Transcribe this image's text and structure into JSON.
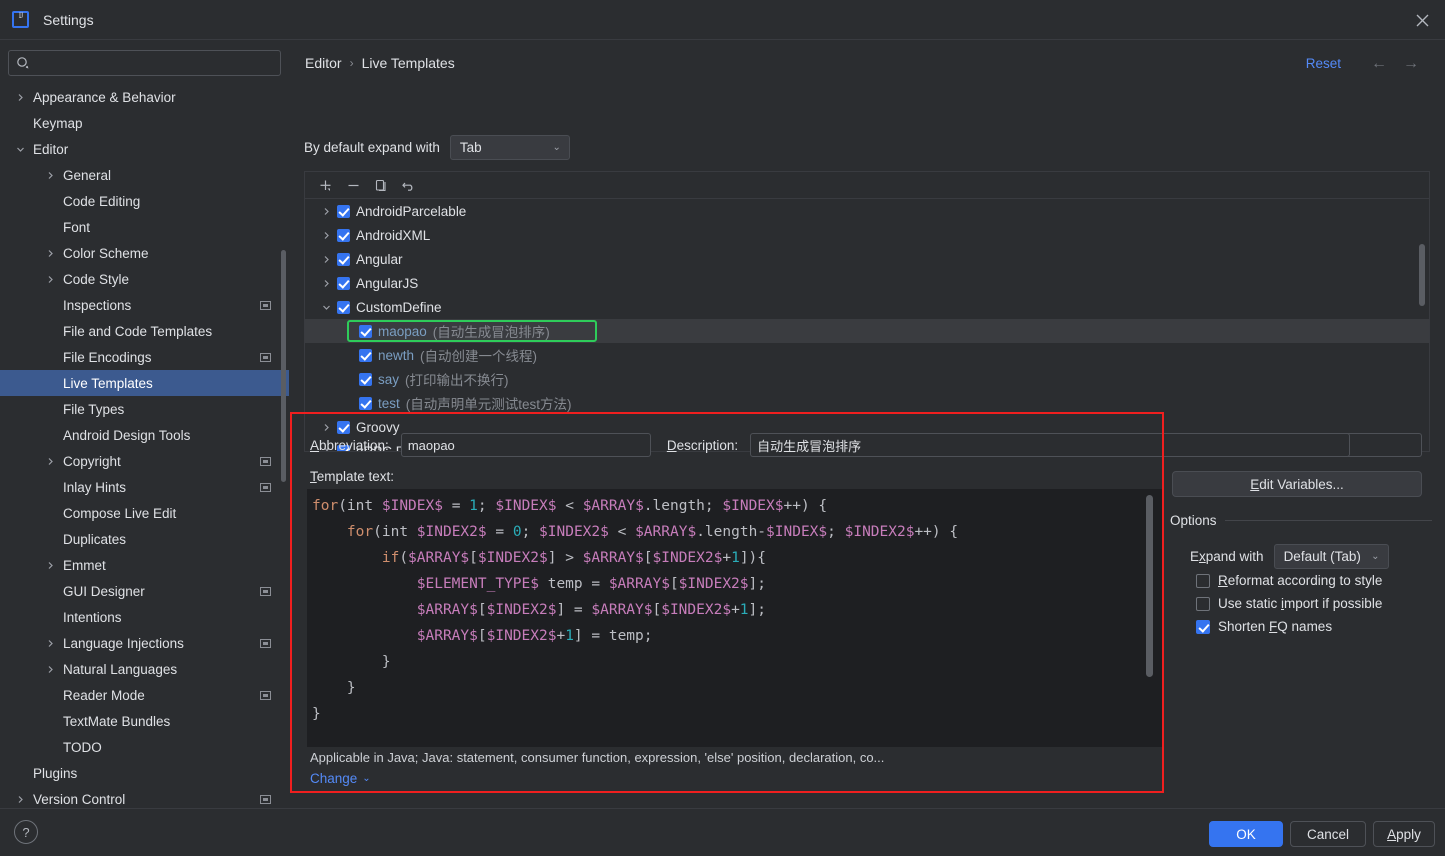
{
  "window": {
    "title": "Settings",
    "logo_icon": "intellij-idea-logo",
    "close_icon": "close-icon"
  },
  "search": {
    "placeholder": "",
    "value": "",
    "icon": "search-icon"
  },
  "sidebar": {
    "items": [
      {
        "label": "Appearance & Behavior",
        "indent": 0,
        "expandable": true,
        "expanded": false,
        "selected": false,
        "badge": false
      },
      {
        "label": "Keymap",
        "indent": 0,
        "expandable": false,
        "expanded": false,
        "selected": false,
        "badge": false
      },
      {
        "label": "Editor",
        "indent": 0,
        "expandable": true,
        "expanded": true,
        "selected": false,
        "badge": false
      },
      {
        "label": "General",
        "indent": 1,
        "expandable": true,
        "expanded": false,
        "selected": false,
        "badge": false
      },
      {
        "label": "Code Editing",
        "indent": 1,
        "expandable": false,
        "expanded": false,
        "selected": false,
        "badge": false
      },
      {
        "label": "Font",
        "indent": 1,
        "expandable": false,
        "expanded": false,
        "selected": false,
        "badge": false
      },
      {
        "label": "Color Scheme",
        "indent": 1,
        "expandable": true,
        "expanded": false,
        "selected": false,
        "badge": false
      },
      {
        "label": "Code Style",
        "indent": 1,
        "expandable": true,
        "expanded": false,
        "selected": false,
        "badge": false
      },
      {
        "label": "Inspections",
        "indent": 1,
        "expandable": false,
        "expanded": false,
        "selected": false,
        "badge": true
      },
      {
        "label": "File and Code Templates",
        "indent": 1,
        "expandable": false,
        "expanded": false,
        "selected": false,
        "badge": false
      },
      {
        "label": "File Encodings",
        "indent": 1,
        "expandable": false,
        "expanded": false,
        "selected": false,
        "badge": true
      },
      {
        "label": "Live Templates",
        "indent": 1,
        "expandable": false,
        "expanded": false,
        "selected": true,
        "badge": false
      },
      {
        "label": "File Types",
        "indent": 1,
        "expandable": false,
        "expanded": false,
        "selected": false,
        "badge": false
      },
      {
        "label": "Android Design Tools",
        "indent": 1,
        "expandable": false,
        "expanded": false,
        "selected": false,
        "badge": false
      },
      {
        "label": "Copyright",
        "indent": 1,
        "expandable": true,
        "expanded": false,
        "selected": false,
        "badge": true
      },
      {
        "label": "Inlay Hints",
        "indent": 1,
        "expandable": false,
        "expanded": false,
        "selected": false,
        "badge": true
      },
      {
        "label": "Compose Live Edit",
        "indent": 1,
        "expandable": false,
        "expanded": false,
        "selected": false,
        "badge": false
      },
      {
        "label": "Duplicates",
        "indent": 1,
        "expandable": false,
        "expanded": false,
        "selected": false,
        "badge": false
      },
      {
        "label": "Emmet",
        "indent": 1,
        "expandable": true,
        "expanded": false,
        "selected": false,
        "badge": false
      },
      {
        "label": "GUI Designer",
        "indent": 1,
        "expandable": false,
        "expanded": false,
        "selected": false,
        "badge": true
      },
      {
        "label": "Intentions",
        "indent": 1,
        "expandable": false,
        "expanded": false,
        "selected": false,
        "badge": false
      },
      {
        "label": "Language Injections",
        "indent": 1,
        "expandable": true,
        "expanded": false,
        "selected": false,
        "badge": true
      },
      {
        "label": "Natural Languages",
        "indent": 1,
        "expandable": true,
        "expanded": false,
        "selected": false,
        "badge": false
      },
      {
        "label": "Reader Mode",
        "indent": 1,
        "expandable": false,
        "expanded": false,
        "selected": false,
        "badge": true
      },
      {
        "label": "TextMate Bundles",
        "indent": 1,
        "expandable": false,
        "expanded": false,
        "selected": false,
        "badge": false
      },
      {
        "label": "TODO",
        "indent": 1,
        "expandable": false,
        "expanded": false,
        "selected": false,
        "badge": false
      },
      {
        "label": "Plugins",
        "indent": 0,
        "expandable": false,
        "expanded": false,
        "selected": false,
        "badge": false
      },
      {
        "label": "Version Control",
        "indent": 0,
        "expandable": true,
        "expanded": false,
        "selected": false,
        "badge": true
      }
    ]
  },
  "header": {
    "breadcrumb": [
      "Editor",
      "Live Templates"
    ],
    "separator": "›",
    "reset_label": "Reset",
    "back_icon": "arrow-left-icon",
    "forward_icon": "arrow-right-icon",
    "back_glyph": "←",
    "forward_glyph": "→"
  },
  "expand_default": {
    "label": "By default expand with",
    "value": "Tab",
    "chevron": "⌄"
  },
  "template_toolbar": {
    "add_icon": "add-icon",
    "remove_icon": "remove-icon",
    "duplicate_icon": "duplicate-icon",
    "revert_icon": "revert-icon"
  },
  "template_tree": {
    "rows": [
      {
        "name": "AndroidParcelable",
        "desc": "",
        "indent": 0,
        "expandable": true,
        "expanded": false,
        "checked": true,
        "selected": false,
        "is_template": false
      },
      {
        "name": "AndroidXML",
        "desc": "",
        "indent": 0,
        "expandable": true,
        "expanded": false,
        "checked": true,
        "selected": false,
        "is_template": false
      },
      {
        "name": "Angular",
        "desc": "",
        "indent": 0,
        "expandable": true,
        "expanded": false,
        "checked": true,
        "selected": false,
        "is_template": false
      },
      {
        "name": "AngularJS",
        "desc": "",
        "indent": 0,
        "expandable": true,
        "expanded": false,
        "checked": true,
        "selected": false,
        "is_template": false
      },
      {
        "name": "CustomDefine",
        "desc": "",
        "indent": 0,
        "expandable": true,
        "expanded": true,
        "checked": true,
        "selected": false,
        "is_template": false
      },
      {
        "name": "maopao",
        "desc": "(自动生成冒泡排序)",
        "indent": 1,
        "expandable": false,
        "expanded": false,
        "checked": true,
        "selected": true,
        "is_template": true
      },
      {
        "name": "newth",
        "desc": "(自动创建一个线程)",
        "indent": 1,
        "expandable": false,
        "expanded": false,
        "checked": true,
        "selected": false,
        "is_template": true
      },
      {
        "name": "say",
        "desc": "(打印输出不换行)",
        "indent": 1,
        "expandable": false,
        "expanded": false,
        "checked": true,
        "selected": false,
        "is_template": true
      },
      {
        "name": "test",
        "desc": "(自动声明单元测试test方法)",
        "indent": 1,
        "expandable": false,
        "expanded": false,
        "checked": true,
        "selected": false,
        "is_template": true
      },
      {
        "name": "Groovy",
        "desc": "",
        "indent": 0,
        "expandable": true,
        "expanded": false,
        "checked": true,
        "selected": false,
        "is_template": false
      },
      {
        "name": "gRPC Request",
        "desc": "",
        "indent": 0,
        "expandable": true,
        "expanded": false,
        "checked": true,
        "selected": false,
        "is_template": false
      }
    ]
  },
  "detail": {
    "abbreviation_label": "Abbreviation:",
    "abbreviation_value": "maopao",
    "description_label": "Description:",
    "description_value": "自动生成冒泡排序",
    "template_text_label": "Template text:",
    "applicable_text": "Applicable in Java; Java: statement, consumer function, expression, 'else' position, declaration, co...",
    "change_label": "Change",
    "change_chevron": "⌄",
    "code_lines": [
      [
        {
          "t": "for",
          "c": "kw"
        },
        {
          "t": "(int ",
          "c": "pl"
        },
        {
          "t": "$INDEX$",
          "c": "var"
        },
        {
          "t": " = ",
          "c": "pl"
        },
        {
          "t": "1",
          "c": "num"
        },
        {
          "t": "; ",
          "c": "pl"
        },
        {
          "t": "$INDEX$",
          "c": "var"
        },
        {
          "t": " < ",
          "c": "pl"
        },
        {
          "t": "$ARRAY$",
          "c": "var"
        },
        {
          "t": ".length; ",
          "c": "pl"
        },
        {
          "t": "$INDEX$",
          "c": "var"
        },
        {
          "t": "++) {",
          "c": "pl"
        }
      ],
      [
        {
          "t": "    ",
          "c": "pl"
        },
        {
          "t": "for",
          "c": "kw"
        },
        {
          "t": "(int ",
          "c": "pl"
        },
        {
          "t": "$INDEX2$",
          "c": "var"
        },
        {
          "t": " = ",
          "c": "pl"
        },
        {
          "t": "0",
          "c": "num"
        },
        {
          "t": "; ",
          "c": "pl"
        },
        {
          "t": "$INDEX2$",
          "c": "var"
        },
        {
          "t": " < ",
          "c": "pl"
        },
        {
          "t": "$ARRAY$",
          "c": "var"
        },
        {
          "t": ".length-",
          "c": "pl"
        },
        {
          "t": "$INDEX$",
          "c": "var"
        },
        {
          "t": "; ",
          "c": "pl"
        },
        {
          "t": "$INDEX2$",
          "c": "var"
        },
        {
          "t": "++) {",
          "c": "pl"
        }
      ],
      [
        {
          "t": "        ",
          "c": "pl"
        },
        {
          "t": "if",
          "c": "kw"
        },
        {
          "t": "(",
          "c": "pl"
        },
        {
          "t": "$ARRAY$",
          "c": "var"
        },
        {
          "t": "[",
          "c": "pl"
        },
        {
          "t": "$INDEX2$",
          "c": "var"
        },
        {
          "t": "] > ",
          "c": "pl"
        },
        {
          "t": "$ARRAY$",
          "c": "var"
        },
        {
          "t": "[",
          "c": "pl"
        },
        {
          "t": "$INDEX2$",
          "c": "var"
        },
        {
          "t": "+",
          "c": "pl"
        },
        {
          "t": "1",
          "c": "num"
        },
        {
          "t": "]){",
          "c": "pl"
        }
      ],
      [
        {
          "t": "            ",
          "c": "pl"
        },
        {
          "t": "$ELEMENT_TYPE$",
          "c": "var"
        },
        {
          "t": " temp = ",
          "c": "pl"
        },
        {
          "t": "$ARRAY$",
          "c": "var"
        },
        {
          "t": "[",
          "c": "pl"
        },
        {
          "t": "$INDEX2$",
          "c": "var"
        },
        {
          "t": "];",
          "c": "pl"
        }
      ],
      [
        {
          "t": "            ",
          "c": "pl"
        },
        {
          "t": "$ARRAY$",
          "c": "var"
        },
        {
          "t": "[",
          "c": "pl"
        },
        {
          "t": "$INDEX2$",
          "c": "var"
        },
        {
          "t": "] = ",
          "c": "pl"
        },
        {
          "t": "$ARRAY$",
          "c": "var"
        },
        {
          "t": "[",
          "c": "pl"
        },
        {
          "t": "$INDEX2$",
          "c": "var"
        },
        {
          "t": "+",
          "c": "pl"
        },
        {
          "t": "1",
          "c": "num"
        },
        {
          "t": "];",
          "c": "pl"
        }
      ],
      [
        {
          "t": "            ",
          "c": "pl"
        },
        {
          "t": "$ARRAY$",
          "c": "var"
        },
        {
          "t": "[",
          "c": "pl"
        },
        {
          "t": "$INDEX2$",
          "c": "var"
        },
        {
          "t": "+",
          "c": "pl"
        },
        {
          "t": "1",
          "c": "num"
        },
        {
          "t": "] = temp;",
          "c": "pl"
        }
      ],
      [
        {
          "t": "        }",
          "c": "pl"
        }
      ],
      [
        {
          "t": "    }",
          "c": "pl"
        }
      ],
      [
        {
          "t": "}",
          "c": "pl"
        }
      ]
    ]
  },
  "options": {
    "edit_variables_label": "Edit Variables...",
    "section_label": "Options",
    "expand_with_label": "Expand with",
    "expand_with_value": "Default (Tab)",
    "expand_chevron": "⌄",
    "checkboxes": [
      {
        "label": "Reformat according to style",
        "checked": false
      },
      {
        "label": "Use static import if possible",
        "checked": false
      },
      {
        "label": "Shorten FQ names",
        "checked": true
      }
    ]
  },
  "footer": {
    "help_icon": "help-icon",
    "help_glyph": "?",
    "ok_label": "OK",
    "cancel_label": "Cancel",
    "apply_label": "Apply"
  },
  "colors": {
    "accent": "#3574f0",
    "link": "#548af7",
    "selection": "#3c5a8f",
    "annotation_red": "#f01f1f",
    "highlight_green": "#2ecc5a",
    "window_bg": "#2b2d30",
    "editor_bg": "#1e1f22"
  }
}
